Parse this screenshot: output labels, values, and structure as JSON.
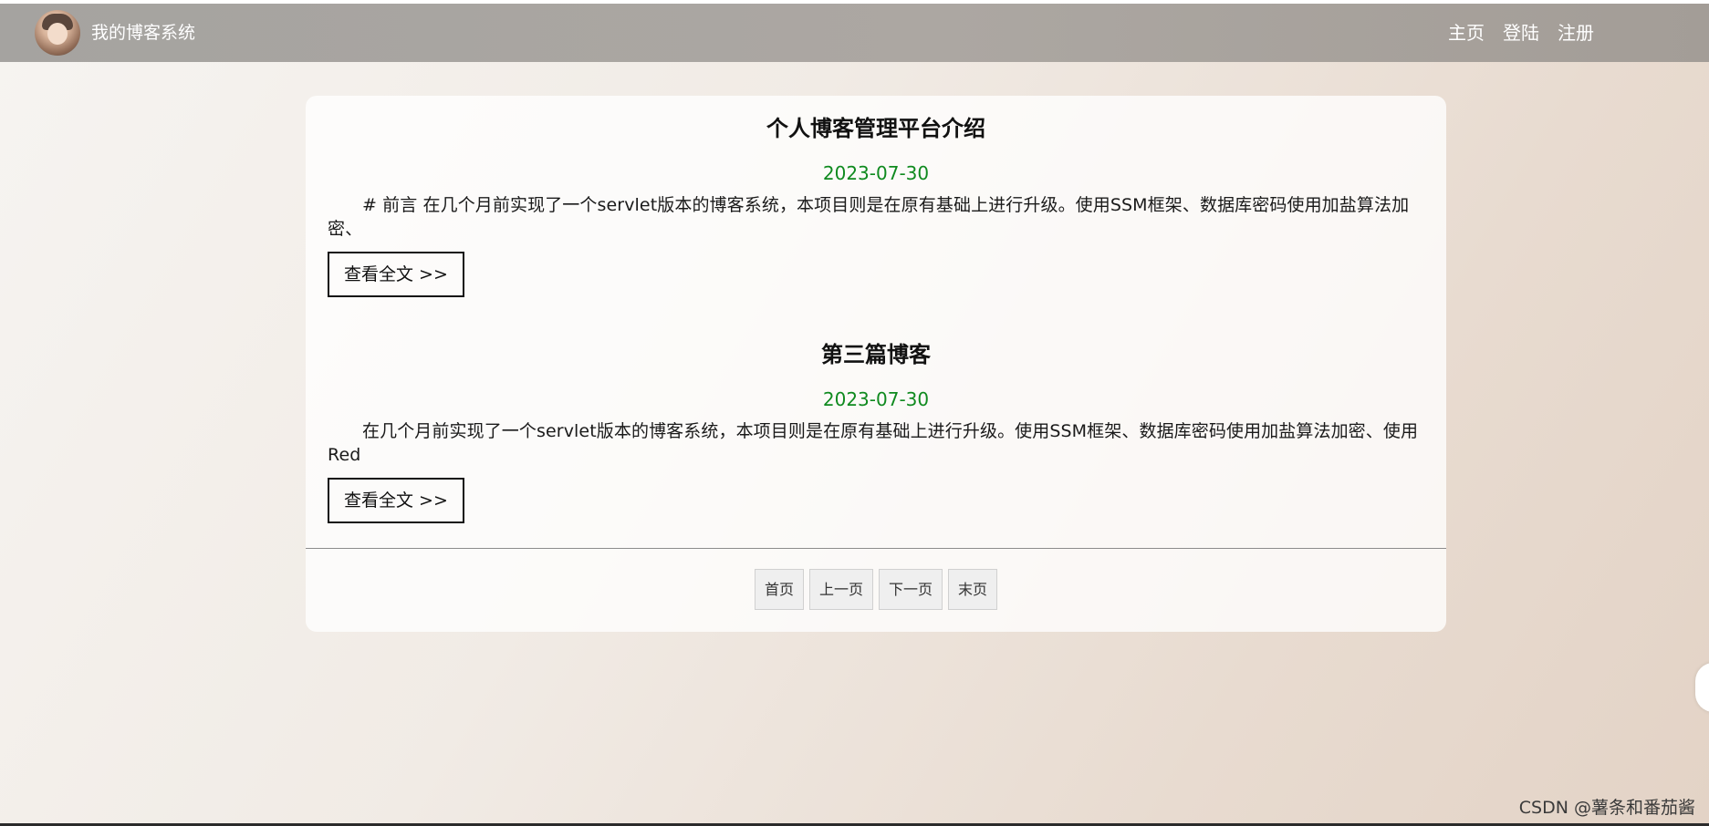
{
  "header": {
    "site_title": "我的博客系统",
    "nav": [
      {
        "label": "主页"
      },
      {
        "label": "登陆"
      },
      {
        "label": "注册"
      }
    ]
  },
  "posts": [
    {
      "title": "个人博客管理平台介绍",
      "date": "2023-07-30",
      "desc": "# 前言 在几个月前实现了一个servlet版本的博客系统，本项目则是在原有基础上进行升级。使用SSM框架、数据库密码使用加盐算法加密、",
      "read_more": "查看全文 >>"
    },
    {
      "title": "第三篇博客",
      "date": "2023-07-30",
      "desc": "在几个月前实现了一个servlet版本的博客系统，本项目则是在原有基础上进行升级。使用SSM框架、数据库密码使用加盐算法加密、使用Red",
      "read_more": "查看全文 >>"
    }
  ],
  "pagination": {
    "first": "首页",
    "prev": "上一页",
    "next": "下一页",
    "last": "末页"
  },
  "watermark": "CSDN @薯条和番茄酱",
  "colors": {
    "date": "#0f8a1f",
    "navbar": "#a7a4a0"
  }
}
